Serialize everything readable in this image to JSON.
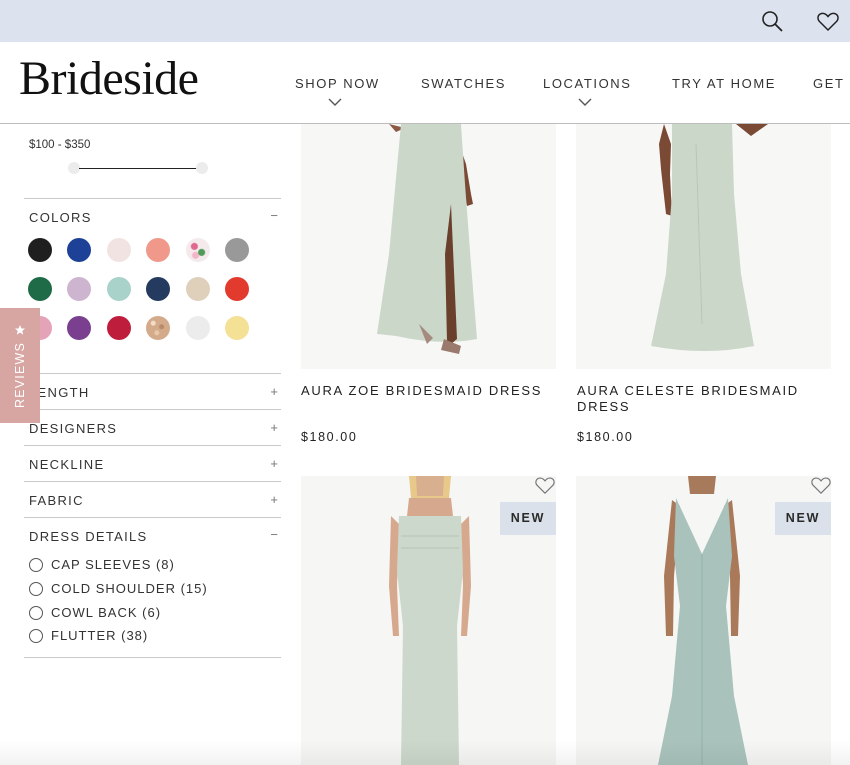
{
  "brand": {
    "logo": "Brideside"
  },
  "topbar": {
    "icons": [
      "search-icon",
      "heart-icon"
    ]
  },
  "nav": {
    "items": [
      {
        "label": "SHOP NOW",
        "has_dropdown": true
      },
      {
        "label": "SWATCHES",
        "has_dropdown": false
      },
      {
        "label": "LOCATIONS",
        "has_dropdown": true
      },
      {
        "label": "TRY AT HOME",
        "has_dropdown": false
      },
      {
        "label": "GET I",
        "has_dropdown": false
      }
    ]
  },
  "filters": {
    "price": {
      "range_label": "$100 - $350",
      "min": 100,
      "max": 350
    },
    "colors": {
      "title": "COLORS",
      "toggle": "−",
      "swatches": [
        "#1f1f1f",
        "#1c4196",
        "#f2e3e3",
        "#f0998a",
        "floral",
        "#999999",
        "#1f6a47",
        "#cdb4cf",
        "#a9d2ca",
        "#243a5e",
        "#dfd0bc",
        "#e33a2e",
        "#e5a3b8",
        "#7a3f8f",
        "#be1e3b",
        "glitter",
        "#ececec",
        "#f4e195"
      ]
    },
    "sections": [
      {
        "title": "LENGTH",
        "toggle": "+"
      },
      {
        "title": "DESIGNERS",
        "toggle": "+"
      },
      {
        "title": "NECKLINE",
        "toggle": "+"
      },
      {
        "title": "FABRIC",
        "toggle": "+"
      }
    ],
    "dress_details": {
      "title": "DRESS DETAILS",
      "toggle": "−",
      "options": [
        "CAP SLEEVES (8)",
        "COLD SHOULDER (15)",
        "COWL BACK (6)",
        "FLUTTER (38)"
      ]
    }
  },
  "reviews_tab": {
    "label": "REVIEWS",
    "icon": "star-icon"
  },
  "products": [
    {
      "name": "AURA ZOE BRIDESMAID DRESS",
      "price": "$180.00"
    },
    {
      "name": "AURA CELESTE BRIDESMAID DRESS",
      "price": "$180.00"
    },
    {
      "badge": "NEW",
      "icon": "heart-outline-icon"
    },
    {
      "badge": "NEW",
      "icon": "heart-outline-icon"
    }
  ],
  "colors": {
    "topbar_bg": "#dde3ee",
    "badge_bg": "#dbe1ea",
    "reviews_bg": "#d7a5a2",
    "dress_sage": "#cbd8c9"
  }
}
